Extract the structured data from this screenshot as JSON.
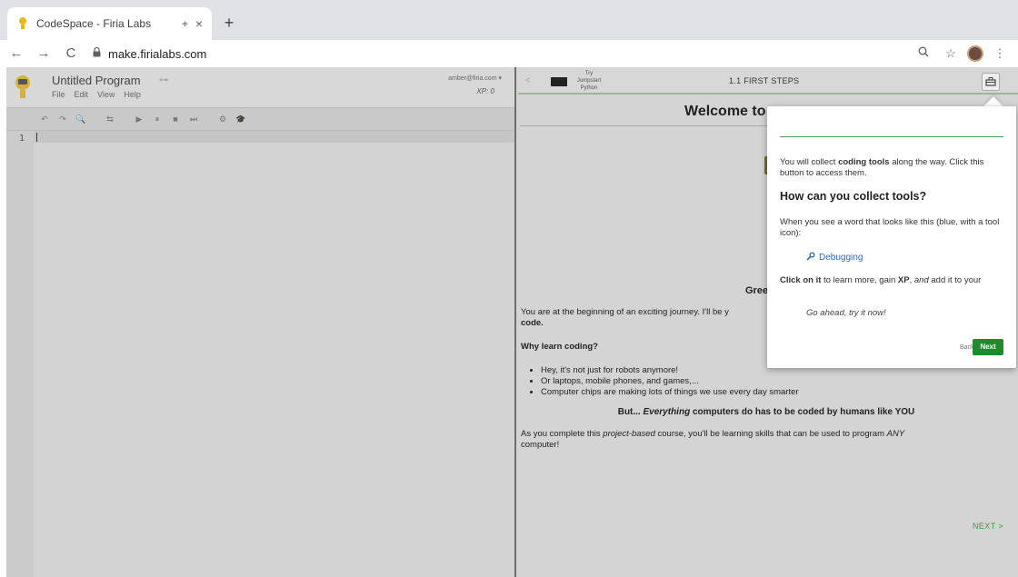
{
  "browser": {
    "tab_title": "CodeSpace - Firia Labs",
    "tab_audio": "🕂",
    "tab_close": "×",
    "new_tab": "+",
    "back": "←",
    "forward": "→",
    "reload": "C",
    "lock": "🔒",
    "url": "make.firialabs.com",
    "zoom": "🔍",
    "star": "☆",
    "menu": "⋮"
  },
  "editor": {
    "program_title": "Untitled Program",
    "usb_icon": "⊶",
    "menu": [
      "File",
      "Edit",
      "View",
      "Help"
    ],
    "user_email": "amber@firia.com ▾",
    "xp": "XP: 0",
    "toolbar": [
      "↶",
      "↷",
      "🔍",
      "⇆",
      "▶",
      "⏸",
      "■",
      "⏭",
      "⚙",
      "🎓"
    ],
    "line_number": "1"
  },
  "lesson": {
    "prev": "<",
    "try_label": "Try Jumpstart Python",
    "title": "1.1 FIRST STEPS",
    "toolbox_icon": "🧰",
    "welcome": "Welcome to",
    "greeting": "Gree",
    "intro_start": "You are at the beginning of an exciting journey. I'll be y",
    "intro_bold": "code.",
    "why_heading": "Why learn coding?",
    "bullets": [
      "Hey, it's not just for robots anymore!",
      "Or laptops, mobile phones, and games,...",
      "Computer chips are making lots of things we use every day smarter"
    ],
    "center_line_prefix": "But...",
    "center_line_em": "Everything",
    "center_line_rest": "computers do has to be coded by humans like YOU",
    "complete_start": "As you complete this",
    "complete_em": "project-based",
    "complete_mid": "course, you'll be learning skills that can be used to program",
    "complete_any": "ANY",
    "complete_end": "computer!",
    "next": "NEXT >"
  },
  "popover": {
    "text1_start": "You will collect",
    "text1_bold": "coding tools",
    "text1_end": "along the way. Click this button to access them.",
    "heading": "How can you collect tools?",
    "text2": "When you see a word that looks like this (blue, with a tool icon):",
    "tool_icon": "🔧",
    "tool_word": "Debugging",
    "text3_bold1": "Click on it",
    "text3_mid": "to learn more, gain",
    "text3_bold2": "XP",
    "text3_and": ", and",
    "text3_em": "and",
    "text3_end": "add it to your",
    "italic": "Go ahead, try it now!",
    "back": "Back",
    "next": "Next"
  },
  "colors": {
    "accent_green": "#1f8a2e",
    "link_blue": "#2a6ac8",
    "next_green": "#3a9a3a"
  }
}
